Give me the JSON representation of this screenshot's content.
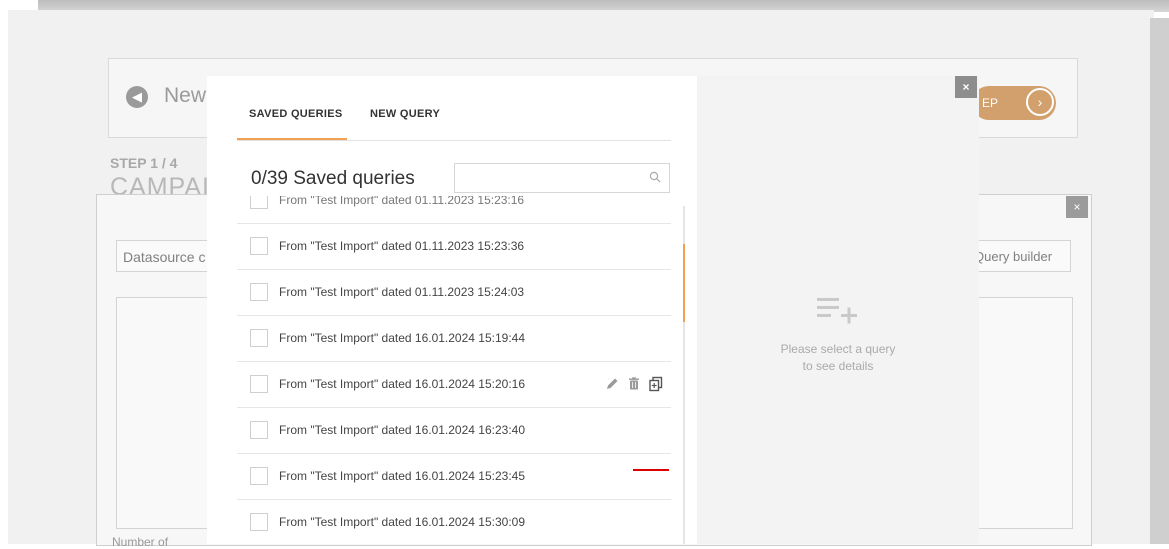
{
  "background": {
    "header_back_label": "New",
    "next_label": "EP",
    "step_label": "STEP 1 / 4",
    "section_title": "CAMPAIGN",
    "datasource_label": "Datasource c",
    "query_builder_label": "Query builder",
    "number_label": "Number of"
  },
  "modal": {
    "close_label": "×",
    "tabs": [
      {
        "label": "SAVED QUERIES",
        "active": true
      },
      {
        "label": "NEW QUERY",
        "active": false
      }
    ],
    "count_title": "0/39 Saved queries",
    "search_placeholder": "",
    "queries": [
      {
        "label": "From \"Test Import\" dated 01.11.2023 15:23:16",
        "checked": false
      },
      {
        "label": "From \"Test Import\" dated 01.11.2023 15:23:36",
        "checked": false
      },
      {
        "label": "From \"Test Import\" dated 01.11.2023 15:24:03",
        "checked": false
      },
      {
        "label": "From \"Test Import\" dated 16.01.2024 15:19:44",
        "checked": false
      },
      {
        "label": "From \"Test Import\" dated 16.01.2024 15:20:16",
        "checked": false
      },
      {
        "label": "From \"Test Import\" dated 16.01.2024 16:23:40",
        "checked": false
      },
      {
        "label": "From \"Test Import\" dated 16.01.2024 15:23:45",
        "checked": false
      },
      {
        "label": "From \"Test Import\" dated 16.01.2024 15:30:09",
        "checked": false
      }
    ],
    "row_actions": [
      "pencil-icon",
      "trash-icon",
      "copy-icon"
    ],
    "details_placeholder_line1": "Please select a query",
    "details_placeholder_line2": "to see details",
    "details_icon": "playlist-add-icon"
  },
  "colors": {
    "accent": "#f0a050",
    "annotation_underline": "#dd0000",
    "overlay_close": "#8d8d8d"
  }
}
